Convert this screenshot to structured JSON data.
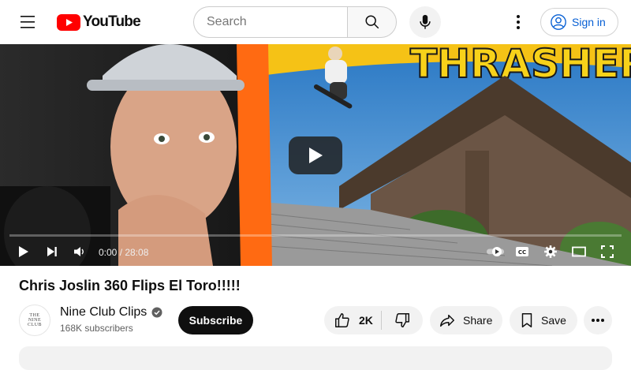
{
  "header": {
    "logo_text": "YouTube",
    "search_placeholder": "Search",
    "signin_label": "Sign in"
  },
  "player": {
    "current_time": "0:00",
    "duration": "28:08",
    "time_display": "0:00 / 28:08",
    "progress_fraction": 0.0,
    "thumbnail_text": "THRASHER"
  },
  "video": {
    "title": "Chris Joslin 360 Flips El Toro!!!!!",
    "channel_name": "Nine Club Clips",
    "subscribers": "168K subscribers",
    "channel_avatar_text": [
      "THE",
      "NINE",
      "CLUB"
    ],
    "verified": true
  },
  "actions": {
    "subscribe_label": "Subscribe",
    "like_count": "2K",
    "share_label": "Share",
    "save_label": "Save"
  },
  "colors": {
    "brand_red": "#ff0000",
    "link_blue": "#065fd4",
    "chip_bg": "#f2f2f2",
    "text_primary": "#0f0f0f"
  }
}
